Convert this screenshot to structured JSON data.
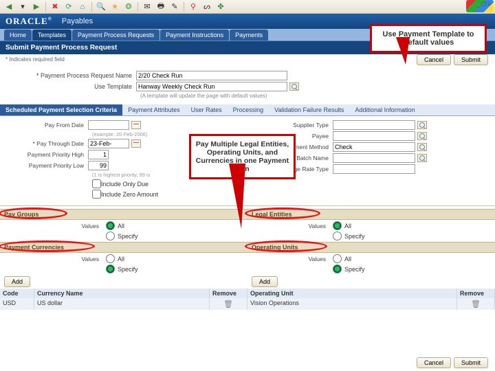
{
  "window": {
    "min": "_",
    "restore": "❐",
    "close": "×"
  },
  "brand": {
    "logo": "ORACLE",
    "app": "Payables"
  },
  "nav": [
    "Home",
    "Templates",
    "Payment Process Requests",
    "Payment Instructions",
    "Payments"
  ],
  "nav_selected": 1,
  "page_title": "Submit Payment Process Request",
  "req_note": "* Indicates required field",
  "buttons": {
    "cancel": "Cancel",
    "submit": "Submit",
    "add": "Add"
  },
  "form": {
    "name_label": "Payment Process Request Name",
    "name_value": "2/20 Check Run",
    "template_label": "Use Template",
    "template_value": "Hanway Weekly Check Run",
    "template_hint": "(A template will update the page with default values)"
  },
  "inner_tabs": [
    "Scheduled Payment Selection Criteria",
    "Payment Attributes",
    "User Rates",
    "Processing",
    "Validation Failure Results",
    "Additional Information"
  ],
  "inner_selected": 0,
  "left": {
    "pay_from": "Pay From Date",
    "pay_from_ex": "(example: 20-Feb-2006)",
    "pay_through": "Pay Through Date",
    "pay_through_val": "23-Feb-",
    "prio_high": "Payment Priority High",
    "prio_high_val": "1",
    "prio_low": "Payment Priority Low",
    "prio_low_val": "99",
    "prio_hint": "(1 is highest priority, 99 is",
    "only_due": "Include Only Due",
    "zero": "Include Zero Amount"
  },
  "right": {
    "supplier": "Supplier Type",
    "payee": "Payee",
    "method": "Payment Method",
    "method_val": "Check",
    "batch": "Invoice Batch Name",
    "rate": "Invoice Exchange Rate Type"
  },
  "sections": {
    "pay_groups": "Pay Groups",
    "legal": "Legal Entities",
    "curr": "Payment Currencies",
    "ou": "Operating Units"
  },
  "values_label": "Values",
  "radio": {
    "all": "All",
    "specify": "Specify"
  },
  "curr_table": {
    "code": "Code",
    "name": "Currency Name",
    "remove": "Remove",
    "row_code": "USD",
    "row_name": "US dollar"
  },
  "ou_table": {
    "ou": "Operating Unit",
    "remove": "Remove",
    "row": "Vision Operations"
  },
  "callout1": "Use Payment Template to Default values",
  "callout2": "Pay Multiple Legal Entities, Operating Units, and Currencies in one Payment Run"
}
